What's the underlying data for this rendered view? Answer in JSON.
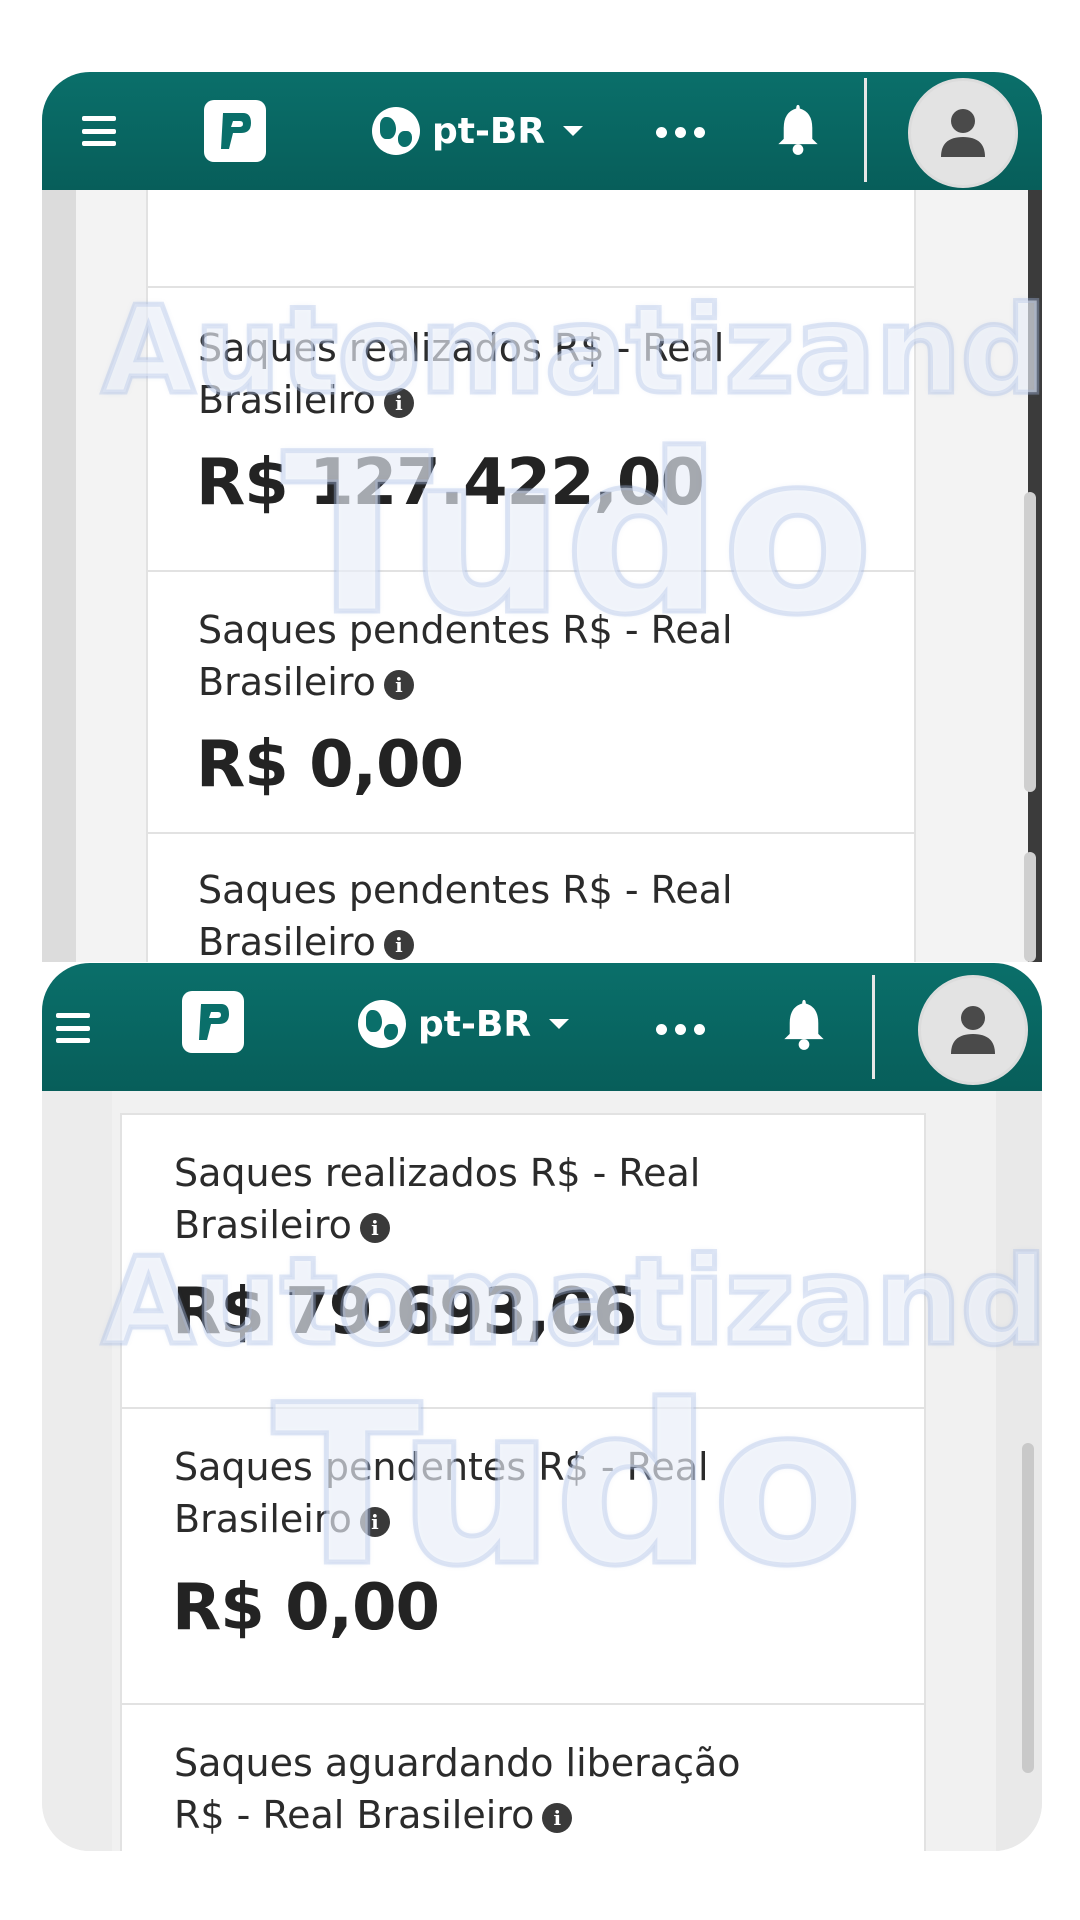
{
  "app": {
    "language_label": "pt-BR",
    "accent_color": "#0a6f6a"
  },
  "watermark": {
    "line1": "Automatizando",
    "line2": "Tudo"
  },
  "screen1": {
    "cards": [
      {
        "label_line1": "Saques realizados R$ - Real",
        "label_line2": "Brasileiro",
        "value": "R$ 127.422,00"
      },
      {
        "label_line1": "Saques pendentes R$ - Real",
        "label_line2": "Brasileiro",
        "value": "R$ 0,00"
      },
      {
        "label_line1": "Saques pendentes R$ - Real",
        "label_line2": "Brasileiro"
      }
    ]
  },
  "screen2": {
    "cards": [
      {
        "label_line1": "Saques realizados R$ - Real",
        "label_line2": "Brasileiro",
        "value": "R$ 79.693,06"
      },
      {
        "label_line1": "Saques pendentes R$ - Real",
        "label_line2": "Brasileiro",
        "value": "R$ 0,00"
      },
      {
        "label_line1": "Saques aguardando liberação",
        "label_line2": "R$ - Real Brasileiro"
      }
    ]
  },
  "icons": {
    "menu": "hamburger-menu-icon",
    "logo": "app-logo-icon",
    "globe": "globe-icon",
    "more": "more-dots-icon",
    "notifications": "bell-icon",
    "user": "user-avatar-icon",
    "info": "info-icon"
  }
}
